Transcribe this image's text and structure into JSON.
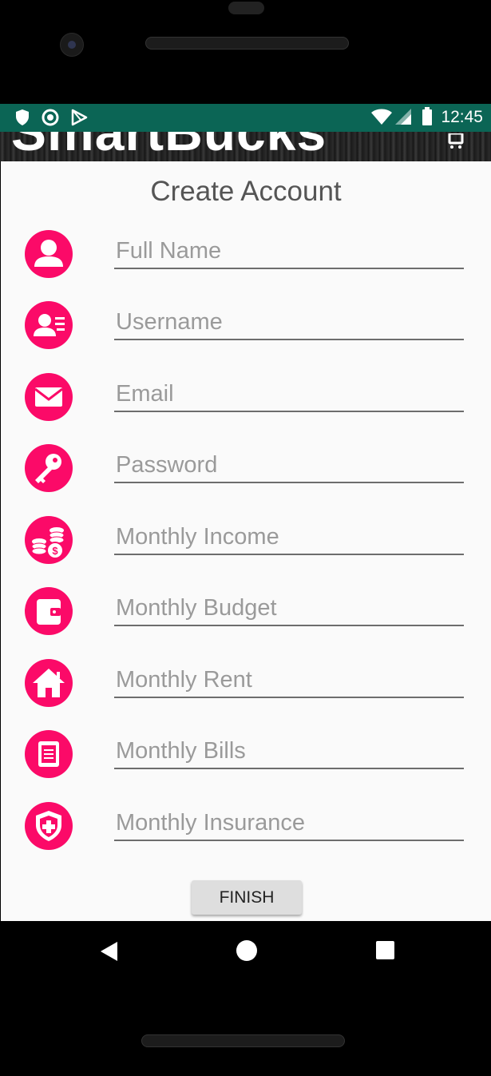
{
  "status_bar": {
    "time": "12:45",
    "left_icons": [
      "shield-icon",
      "circle-dot-icon",
      "play-store-icon"
    ],
    "right_icons": [
      "wifi-icon",
      "cell-signal-icon",
      "battery-icon"
    ],
    "background": "#0b6555"
  },
  "app_bar": {
    "title": "SmartBucks",
    "action_icon": "cart-icon"
  },
  "page": {
    "title": "Create Account"
  },
  "form": {
    "fields": [
      {
        "icon": "person-icon",
        "placeholder": "Full Name",
        "value": ""
      },
      {
        "icon": "id-card-icon",
        "placeholder": "Username",
        "value": ""
      },
      {
        "icon": "envelope-icon",
        "placeholder": "Email",
        "value": ""
      },
      {
        "icon": "key-icon",
        "placeholder": "Password",
        "value": ""
      },
      {
        "icon": "coins-icon",
        "placeholder": "Monthly Income",
        "value": ""
      },
      {
        "icon": "wallet-icon",
        "placeholder": "Monthly Budget",
        "value": ""
      },
      {
        "icon": "house-icon",
        "placeholder": "Monthly Rent",
        "value": ""
      },
      {
        "icon": "bill-icon",
        "placeholder": "Monthly Bills",
        "value": ""
      },
      {
        "icon": "shield-plus-icon",
        "placeholder": "Monthly Insurance",
        "value": ""
      }
    ],
    "submit_label": "FINISH"
  },
  "nav_bar": {
    "icons": [
      "back-icon",
      "home-icon",
      "recents-icon"
    ]
  },
  "colors": {
    "accent": "#fb0a68",
    "underline": "#6d6d6d",
    "placeholder": "#9a9a9a",
    "title": "#555555",
    "background": "#fafafa"
  }
}
